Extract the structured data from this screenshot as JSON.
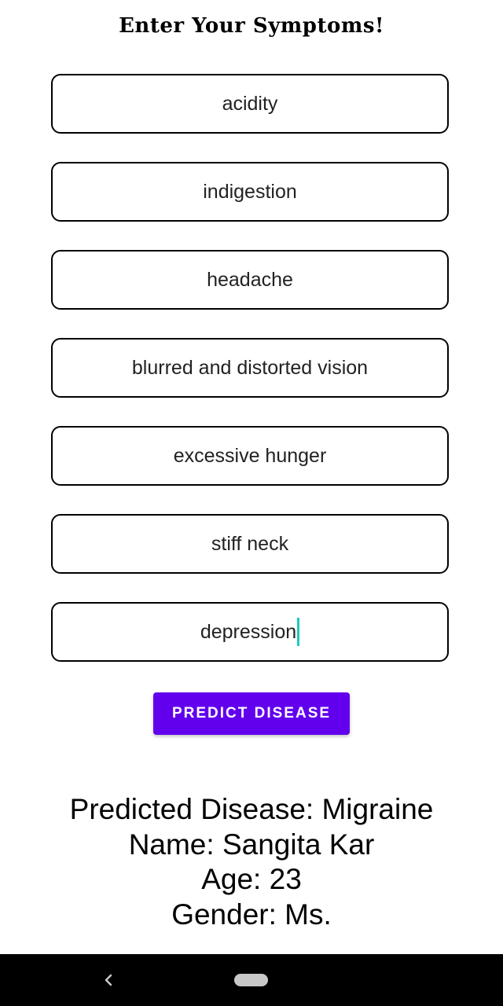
{
  "header": {
    "title": "Enter Your Symptoms!"
  },
  "symptoms": [
    {
      "value": "acidity"
    },
    {
      "value": "indigestion"
    },
    {
      "value": "headache"
    },
    {
      "value": "blurred and distorted vision"
    },
    {
      "value": "excessive hunger"
    },
    {
      "value": "stiff neck"
    },
    {
      "value": "depression"
    }
  ],
  "actions": {
    "predict_label": "PREDICT DISEASE"
  },
  "result": {
    "disease_line": "Predicted Disease: Migraine",
    "name_line": "Name: Sangita Kar",
    "age_line": "Age: 23",
    "gender_line": "Gender: Ms."
  },
  "colors": {
    "accent": "#6200ee",
    "caret": "#1ec9c1",
    "field_border": "#000000",
    "nav_bar": "#000000"
  },
  "icons": {
    "back": "back-chevron-icon",
    "home": "home-pill-icon"
  }
}
